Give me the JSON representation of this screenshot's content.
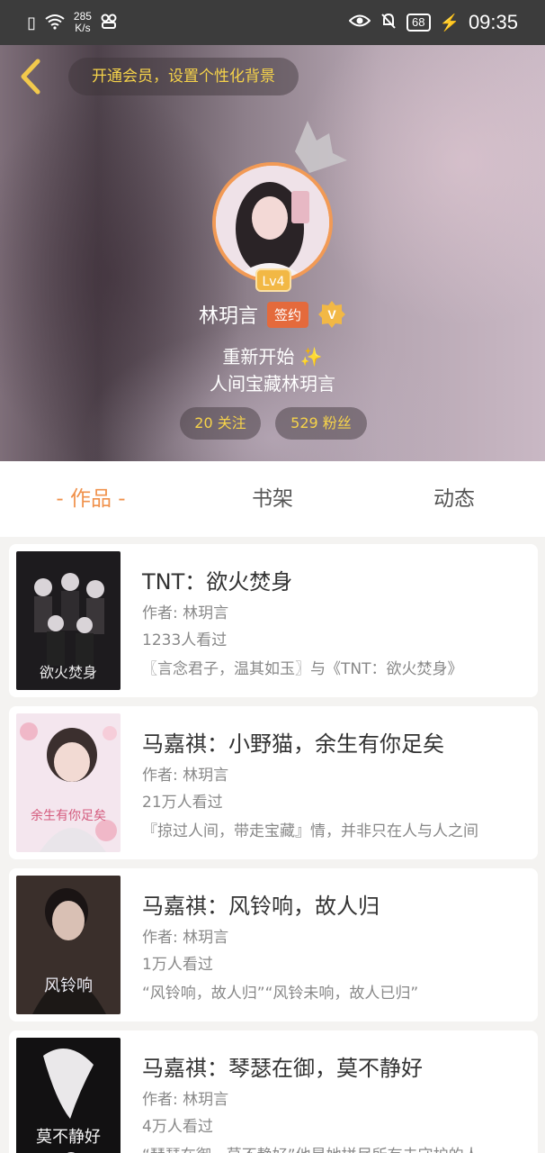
{
  "status_bar": {
    "net_speed_value": "285",
    "net_speed_unit": "K/s",
    "battery": "68",
    "time": "09:35"
  },
  "header": {
    "vip_prompt": "开通会员，设置个性化背景"
  },
  "profile": {
    "level": "Lv4",
    "name": "林玥言",
    "signed_badge": "签约",
    "verified_label": "V",
    "bio_line1": "重新开始 ✨",
    "bio_line2": "人间宝藏林玥言",
    "following": "20 关注",
    "followers": "529 粉丝"
  },
  "tabs": [
    {
      "label": "- 作品 -",
      "active": true
    },
    {
      "label": "书架",
      "active": false
    },
    {
      "label": "动态",
      "active": false
    }
  ],
  "works": [
    {
      "title": "TNT：欲火焚身",
      "author": "作者: 林玥言",
      "views": "1233人看过",
      "desc": "〖言念君子，温其如玉〗与《TNT：欲火焚身》",
      "cover_text": "欲火焚身"
    },
    {
      "title": "马嘉祺：小野猫，余生有你足矣",
      "author": "作者: 林玥言",
      "views": "21万人看过",
      "desc": "『掠过人间，带走宝藏』情，并非只在人与人之间",
      "cover_text": "余生有你足矣"
    },
    {
      "title": "马嘉祺：风铃响，故人归",
      "author": "作者: 林玥言",
      "views": "1万人看过",
      "desc": "“风铃响，故人归”“风铃未响，故人已归”",
      "cover_text": "风铃响"
    },
    {
      "title": "马嘉祺：琴瑟在御，莫不静好",
      "author": "作者: 林玥言",
      "views": "4万人看过",
      "desc": "“琴瑟在御，莫不静好”他是她拼尽所有去守护的人",
      "cover_text": "莫不静好"
    }
  ],
  "colors": {
    "accent": "#f0914b",
    "gold": "#f6d34a",
    "signed": "#e46a3c"
  }
}
